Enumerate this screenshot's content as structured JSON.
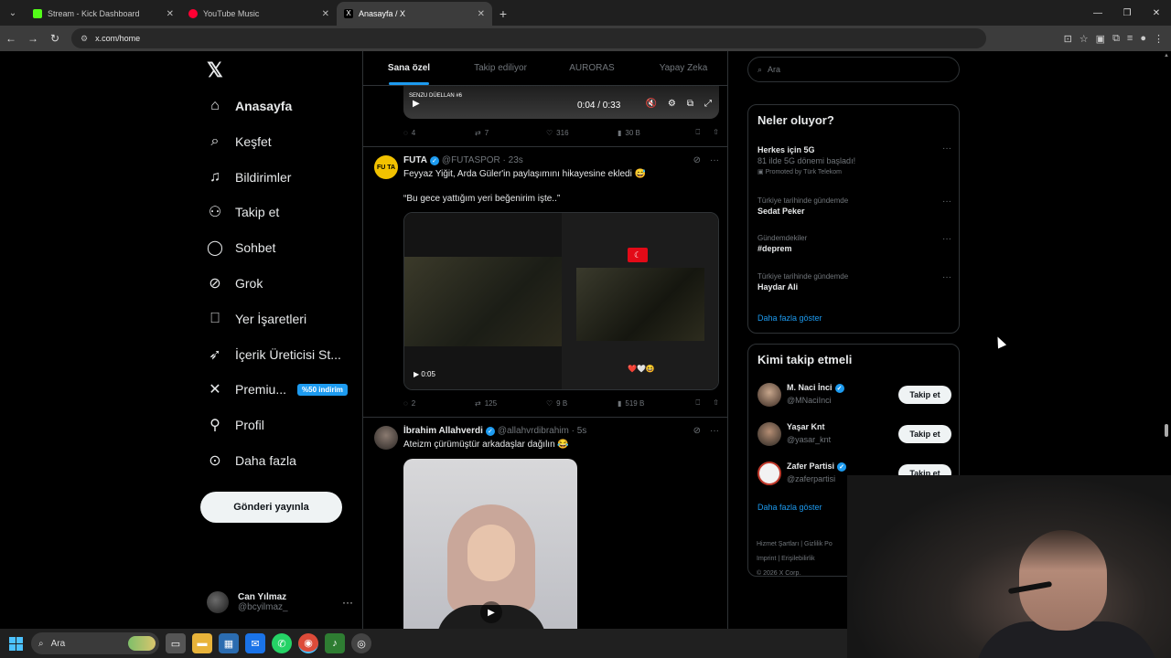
{
  "browser": {
    "tabs": [
      {
        "title": "Stream - Kick Dashboard",
        "favicon_color": "#53fc18",
        "active": false
      },
      {
        "title": "YouTube Music",
        "favicon_color": "#ff0033",
        "active": false
      },
      {
        "title": "Anasayfa / X",
        "favicon_color": "#ffffff",
        "active": true
      }
    ],
    "url": "x.com/home"
  },
  "leftnav": {
    "items": [
      {
        "label": "Anasayfa",
        "icon": "home-icon",
        "glyph": "⌂"
      },
      {
        "label": "Keşfet",
        "icon": "search-icon",
        "glyph": "⌕"
      },
      {
        "label": "Bildirimler",
        "icon": "bell-icon",
        "glyph": "🔔"
      },
      {
        "label": "Takip et",
        "icon": "add-person-icon",
        "glyph": "👤"
      },
      {
        "label": "Sohbet",
        "icon": "chat-icon",
        "glyph": "◯"
      },
      {
        "label": "Grok",
        "icon": "grok-icon",
        "glyph": "⊘"
      },
      {
        "label": "Yer İşaretleri",
        "icon": "bookmark-icon",
        "glyph": "⎕"
      },
      {
        "label": "İçerik Üreticisi St...",
        "icon": "rocket-icon",
        "glyph": "➶"
      },
      {
        "label": "Premiu...",
        "icon": "x-premium-icon",
        "glyph": "✕"
      },
      {
        "label": "Profil",
        "icon": "person-icon",
        "glyph": "⚇"
      },
      {
        "label": "Daha fazla",
        "icon": "more-circle-icon",
        "glyph": "⋯"
      }
    ],
    "premium_badge": "%50 indirim",
    "post_button": "Gönderi yayınla",
    "profile": {
      "name": "Can Yılmaz",
      "handle": "@bcyilmaz_"
    }
  },
  "timeline": {
    "tabs": [
      "Sana özel",
      "Takip ediliyor",
      "AURORAS",
      "Yapay Zeka"
    ],
    "top_video": {
      "overlay_label": "SENZU DÜELLAN #6",
      "time": "0:04 / 0:33",
      "stats": {
        "replies": "4",
        "reposts": "7",
        "likes": "316",
        "views": "30 B"
      }
    },
    "posts": [
      {
        "name": "FUTA",
        "handle": "@FUTASPOR",
        "time": "23s",
        "text1": "Feyyaz Yiğit, Arda Güler'in paylaşımını hikayesine ekledi 😅",
        "text2": "“Bu gece yattığım yeri beğenirim işte..”",
        "video_duration": "0:05",
        "hearts": "❤️🤍😆",
        "stats": {
          "replies": "2",
          "reposts": "125",
          "likes": "9 B",
          "views": "519 B"
        }
      },
      {
        "name": "İbrahim Allahverdi",
        "handle": "@allahvrdibrahim",
        "time": "5s",
        "text1": "Ateizm çürümüştür arkadaşlar dağılın 😂"
      }
    ]
  },
  "right": {
    "search_placeholder": "Ara",
    "trends_title": "Neler oluyor?",
    "trends": [
      {
        "context": "",
        "name": "Herkes için 5G",
        "sub": "81 ilde 5G dönemi başladı!",
        "promo": "Promoted by Türk Telekom"
      },
      {
        "context": "Türkiye tarihinde gündemde",
        "name": "Sedat Peker",
        "sub": "",
        "promo": ""
      },
      {
        "context": "Gündemdekiler",
        "name": "#deprem",
        "sub": "",
        "promo": ""
      },
      {
        "context": "Türkiye tarihinde gündemde",
        "name": "Haydar Ali",
        "sub": "",
        "promo": ""
      }
    ],
    "show_more": "Daha fazla göster",
    "wtf_title": "Kimi takip etmeli",
    "who_to_follow": [
      {
        "name": "M. Naci İnci",
        "handle": "@MNaciInci",
        "verified": true,
        "button": "Takip et"
      },
      {
        "name": "Yaşar Knt",
        "handle": "@yasar_knt",
        "verified": false,
        "button": "Takip et"
      },
      {
        "name": "Zafer Partisi",
        "handle": "@zaferpartisi",
        "verified": true,
        "button": "Takip et"
      }
    ],
    "wtf_show_more": "Daha fazla göster",
    "footer": [
      "Hizmet Şartları",
      "Gizlilik Po",
      "Imprint",
      "Erişilebilirlik",
      "© 2026 X Corp."
    ]
  },
  "taskbar": {
    "search_label": "Ara"
  }
}
